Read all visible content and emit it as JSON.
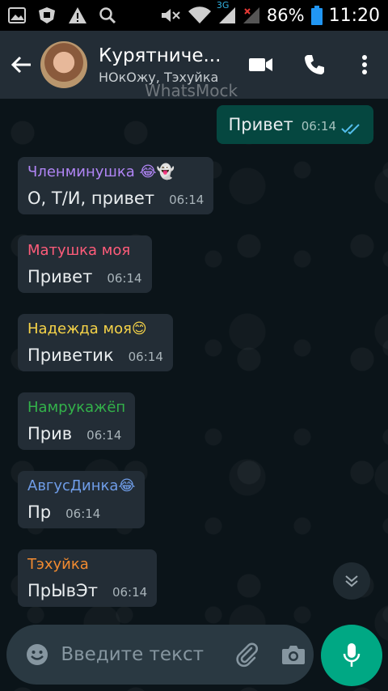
{
  "status_bar": {
    "battery_percent": "86%",
    "time": "11:20",
    "network_type": "3G",
    "icons": [
      "image-icon",
      "shield-icon",
      "warning-icon",
      "search-icon",
      "mute-icon",
      "wifi-icon",
      "signal-icon",
      "signal-off-icon",
      "battery-icon"
    ]
  },
  "header": {
    "title": "Курятниче...",
    "subtitle": "НОкОжу, Тэхуйка",
    "icons": [
      "back-arrow-icon",
      "video-call-icon",
      "phone-icon",
      "more-vert-icon"
    ]
  },
  "watermark": "WhatsMock",
  "messages": [
    {
      "direction": "out",
      "text": "Привет",
      "time": "06:14",
      "status": "read"
    },
    {
      "direction": "in",
      "sender": "Членминушка 😂👻",
      "sender_color": "#b085f5",
      "text": "О, Т/И, привет",
      "time": "06:14"
    },
    {
      "direction": "in",
      "sender": "Матушка моя",
      "sender_color": "#ff5c7a",
      "text": "Привет",
      "time": "06:14"
    },
    {
      "direction": "in",
      "sender": "Надежда моя😊",
      "sender_color": "#f7d448",
      "text": "Приветик",
      "time": "06:14"
    },
    {
      "direction": "in",
      "sender": "Намрукажёп",
      "sender_color": "#33b24a",
      "text": "Прив",
      "time": "06:14"
    },
    {
      "direction": "in",
      "sender": "АвгусДинка😂",
      "sender_color": "#6f9de8",
      "text": "Пр",
      "time": "06:14"
    },
    {
      "direction": "in",
      "sender": "Тэхуйка",
      "sender_color": "#f28b30",
      "text": "ПрЫвЭт",
      "time": "06:14"
    }
  ],
  "input": {
    "placeholder": "Введите текст",
    "value": ""
  },
  "colors": {
    "header_bg": "#232d36",
    "incoming_bubble": "#232d36",
    "outgoing_bubble": "#054740",
    "accent": "#00a884",
    "read_ticks": "#53bdeb"
  }
}
